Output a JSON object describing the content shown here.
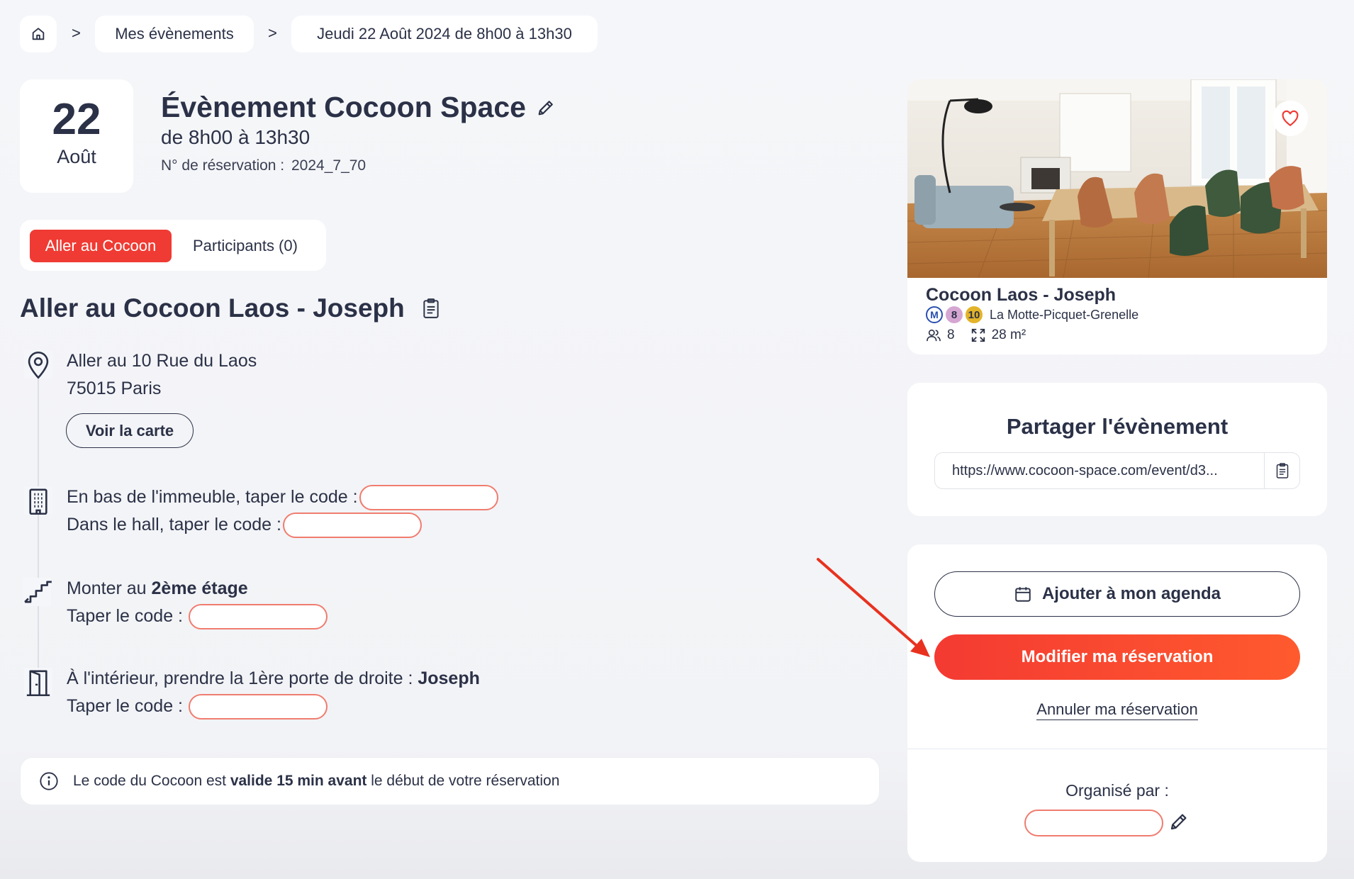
{
  "breadcrumb": {
    "home_icon": "home-icon",
    "items": [
      "Mes évènements",
      "Jeudi 22 Août 2024 de 8h00 à 13h30"
    ],
    "separator": ">"
  },
  "event": {
    "day": "22",
    "month": "Août",
    "title": "Évènement Cocoon Space",
    "time": "de 8h00 à 13h30",
    "reservation_label": "N° de réservation :",
    "reservation_number": "2024_7_70"
  },
  "tabs": [
    {
      "label": "Aller au Cocoon",
      "active": true
    },
    {
      "label": "Participants (0)",
      "active": false
    }
  ],
  "directions": {
    "title": "Aller au Cocoon Laos - Joseph",
    "address_line1": "Aller au 10 Rue du Laos",
    "address_line2": "75015 Paris",
    "map_button": "Voir la carte",
    "building_code": "En bas de l'immeuble, taper le code :",
    "hall_code": "Dans le hall, taper le code :",
    "floor_prefix": "Monter au ",
    "floor_value": "2ème étage",
    "floor_code": "Taper le code :",
    "door_prefix": "À l'intérieur, prendre la 1ère porte de droite : ",
    "door_value": "Joseph",
    "door_code": "Taper le code :"
  },
  "info": {
    "prefix": "Le code du Cocoon est ",
    "bold": "valide 15 min avant",
    "suffix": " le début de votre réservation"
  },
  "place": {
    "name": "Cocoon Laos - Joseph",
    "metro_letter": "M",
    "lines": [
      {
        "number": "8",
        "color": "#d6a6d3"
      },
      {
        "number": "10",
        "color": "#e3b32a"
      }
    ],
    "station": "La Motte-Picquet-Grenelle",
    "capacity": "8",
    "area": "28 m²"
  },
  "share": {
    "title": "Partager l'évènement",
    "url": "https://www.cocoon-space.com/event/d3..."
  },
  "actions": {
    "agenda": "Ajouter à mon agenda",
    "modify": "Modifier ma réservation",
    "cancel": "Annuler ma réservation",
    "organized_by": "Organisé par :"
  },
  "colors": {
    "accent": "#ef3b33",
    "text": "#2b3147",
    "code_outline": "#f07c6f",
    "arrow": "#e8321f"
  }
}
